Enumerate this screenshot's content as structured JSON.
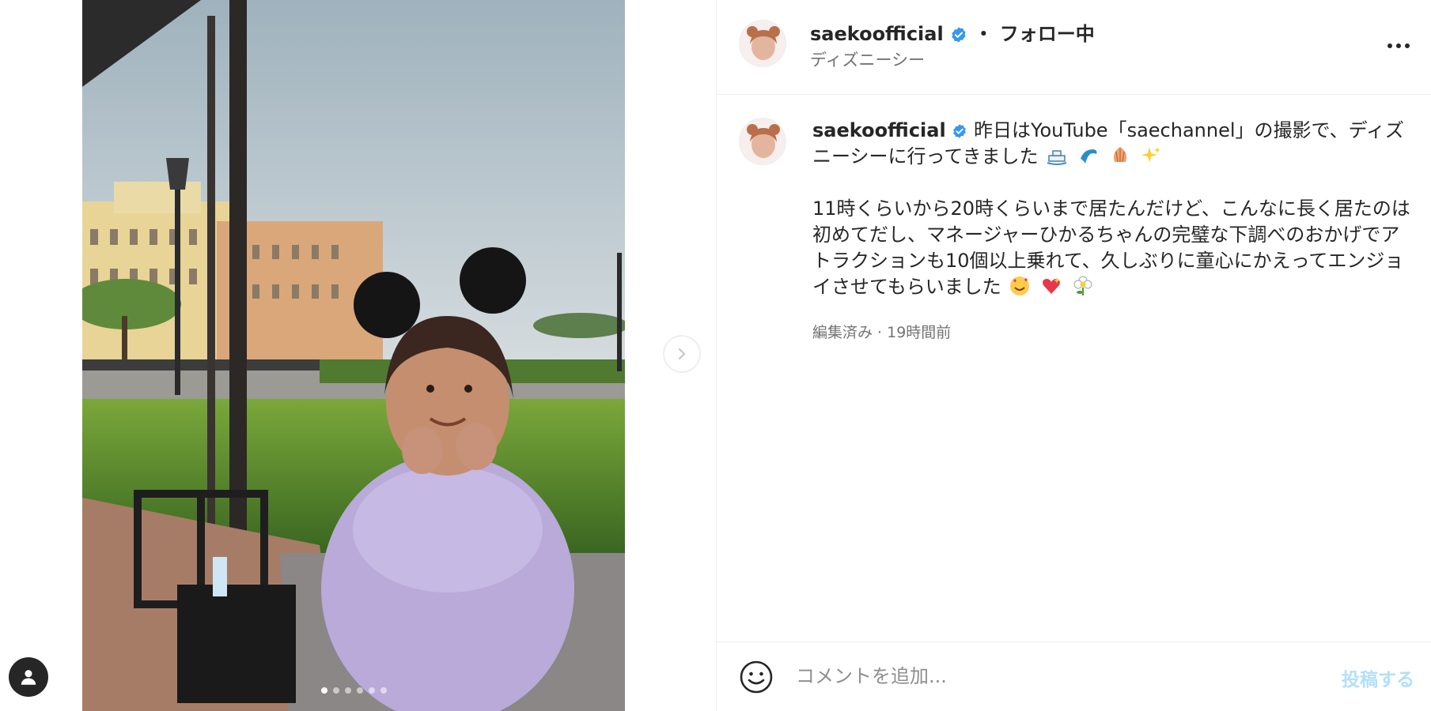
{
  "post": {
    "username": "saekoofficial",
    "separator": "・",
    "follow_label": "フォロー中",
    "location": "ディズニーシー",
    "caption_line1": "昨日はYouTube「saechannel」の撮影で、ディズニーシーに行ってきました",
    "caption_paragraph2": "11時くらいから20時くらいまで居たんだけど、こんなに長く居たのは初めてだし、マネージャーひかるちゃんの完璧な下調べのおかげでアトラクションも10個以上乗れて、久しぶりに童心にかえってエンジョイさせてもらいました",
    "meta": "編集済み · 19時間前",
    "caption_emojis_1": [
      "ship-emoji",
      "dolphin-emoji",
      "shell-emoji",
      "sparkles-emoji"
    ],
    "caption_emojis_2": [
      "smiling-hearts-emoji",
      "sparkling-heart-emoji",
      "flower-emoji"
    ]
  },
  "carousel": {
    "count": 6,
    "active_index": 0
  },
  "comment": {
    "placeholder": "コメントを追加...",
    "post_label": "投稿する"
  },
  "colors": {
    "verified": "#3897f0",
    "post_button_disabled": "#b2dffc",
    "muted_text": "#737373"
  }
}
